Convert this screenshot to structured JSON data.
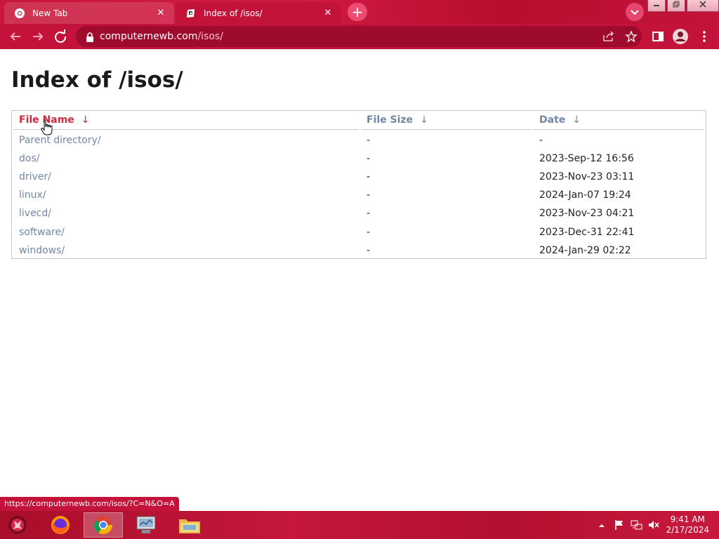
{
  "browser": {
    "tabs": [
      {
        "title": "New Tab",
        "active": false
      },
      {
        "title": "Index of /isos/",
        "active": true
      }
    ],
    "close_symbol": "✕",
    "new_tab_symbol": "+",
    "url_domain": "computernewb.com",
    "url_path": "/isos/",
    "accent_color": "#c4133a"
  },
  "page": {
    "title": "Index of /isos/",
    "columns": [
      {
        "label": "File Name",
        "sort_arrow": "↓"
      },
      {
        "label": "File Size",
        "sort_arrow": "↓"
      },
      {
        "label": "Date",
        "sort_arrow": "↓"
      }
    ],
    "rows": [
      {
        "name": "Parent directory/",
        "size": "-",
        "date": "-"
      },
      {
        "name": "dos/",
        "size": "-",
        "date": "2023-Sep-12 16:56"
      },
      {
        "name": "driver/",
        "size": "-",
        "date": "2023-Nov-23 03:11"
      },
      {
        "name": "linux/",
        "size": "-",
        "date": "2024-Jan-07 19:24"
      },
      {
        "name": "livecd/",
        "size": "-",
        "date": "2023-Nov-23 04:21"
      },
      {
        "name": "software/",
        "size": "-",
        "date": "2023-Dec-31 22:41"
      },
      {
        "name": "windows/",
        "size": "-",
        "date": "2024-Jan-29 02:22"
      }
    ],
    "link_color": "#7087a8",
    "active_sort_color": "#cd2a3e"
  },
  "status_bar": {
    "url": "https://computernewb.com/isos/?C=N&O=A"
  },
  "taskbar": {
    "apps": [
      "firefox-icon",
      "chrome-icon",
      "system-monitor-icon",
      "file-explorer-icon"
    ],
    "time": "9:41 AM",
    "date": "2/17/2024"
  }
}
